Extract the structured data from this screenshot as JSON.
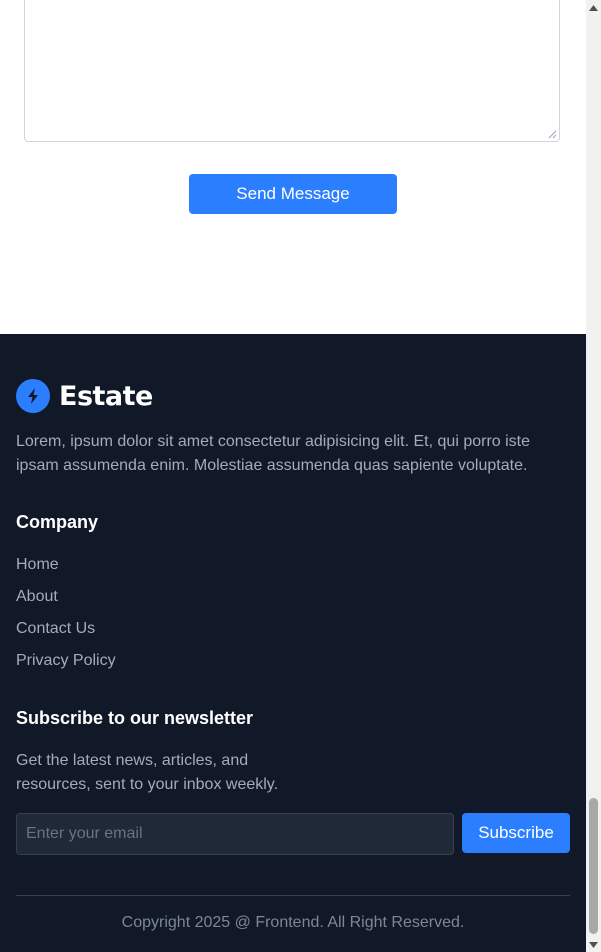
{
  "contact_form": {
    "send_label": "Send Message"
  },
  "footer": {
    "brand_name": "Estate",
    "description": "Lorem, ipsum dolor sit amet consectetur adipisicing elit. Et, qui porro iste ipsam assumenda enim. Molestiae assumenda quas sapiente voluptate.",
    "company": {
      "title": "Company",
      "links": [
        "Home",
        "About",
        "Contact Us",
        "Privacy Policy"
      ]
    },
    "newsletter": {
      "title": "Subscribe to our newsletter",
      "description": "Get the latest news, articles, and resources, sent to your inbox weekly.",
      "email_placeholder": "Enter your email",
      "subscribe_label": "Subscribe"
    },
    "copyright": "Copyright 2025 @ Frontend. All Right Reserved."
  },
  "colors": {
    "accent": "#2b7fff",
    "footer_bg": "#111827",
    "muted_text": "#a3acb9"
  },
  "icons": {
    "brand": "lightning-bolt-icon"
  }
}
